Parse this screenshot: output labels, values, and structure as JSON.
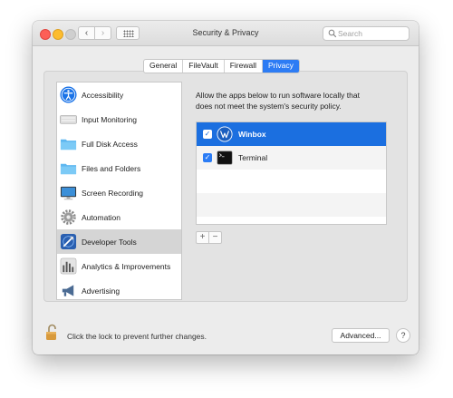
{
  "window": {
    "title": "Security & Privacy",
    "search_placeholder": "Search"
  },
  "tabs": [
    {
      "label": "General",
      "active": false
    },
    {
      "label": "FileVault",
      "active": false
    },
    {
      "label": "Firewall",
      "active": false
    },
    {
      "label": "Privacy",
      "active": true
    }
  ],
  "categories": [
    {
      "label": "Accessibility",
      "icon": "accessibility-icon"
    },
    {
      "label": "Input Monitoring",
      "icon": "keyboard-icon"
    },
    {
      "label": "Full Disk Access",
      "icon": "folder-icon"
    },
    {
      "label": "Files and Folders",
      "icon": "folder-icon"
    },
    {
      "label": "Screen Recording",
      "icon": "display-icon"
    },
    {
      "label": "Automation",
      "icon": "gear-icon"
    },
    {
      "label": "Developer Tools",
      "icon": "developer-tools-icon",
      "selected": true
    },
    {
      "label": "Analytics & Improvements",
      "icon": "bar-chart-icon"
    },
    {
      "label": "Advertising",
      "icon": "megaphone-icon"
    }
  ],
  "privacy": {
    "description": "Allow the apps below to run software locally that does not meet the system's security policy.",
    "apps": [
      {
        "name": "Winbox",
        "checked": true,
        "selected": true,
        "icon": "winbox-icon"
      },
      {
        "name": "Terminal",
        "checked": true,
        "selected": false,
        "icon": "terminal-icon"
      }
    ],
    "add_label": "+",
    "remove_label": "−"
  },
  "footer": {
    "lock_text": "Click the lock to prevent further changes.",
    "advanced_label": "Advanced...",
    "help_label": "?"
  },
  "colors": {
    "accent": "#2d7cf4",
    "selection": "#1b6fe0",
    "window_bg": "#ececec"
  }
}
